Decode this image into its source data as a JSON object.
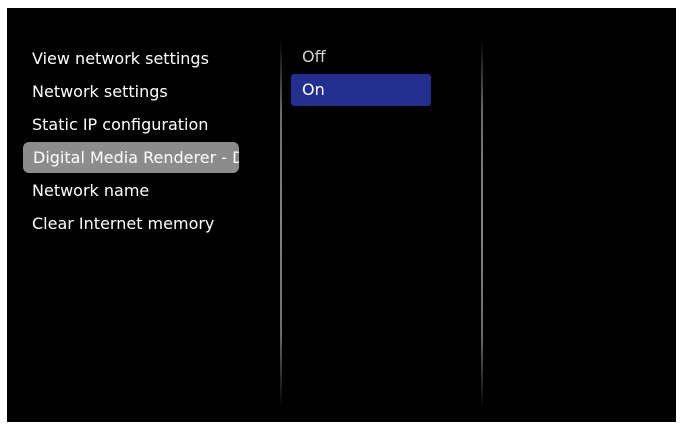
{
  "menu": {
    "items": [
      {
        "label": "View network settings"
      },
      {
        "label": "Network settings"
      },
      {
        "label": "Static IP configuration"
      },
      {
        "label": "Digital Media Renderer - D..."
      },
      {
        "label": "Network name"
      },
      {
        "label": "Clear Internet memory"
      }
    ],
    "selected_index": 3
  },
  "options": {
    "items": [
      {
        "label": "Off"
      },
      {
        "label": "On"
      }
    ],
    "selected_index": 1
  },
  "colors": {
    "background": "#000000",
    "menu_highlight": "#8c8c8c",
    "option_highlight": "#232f8f",
    "text": "#ffffff"
  }
}
